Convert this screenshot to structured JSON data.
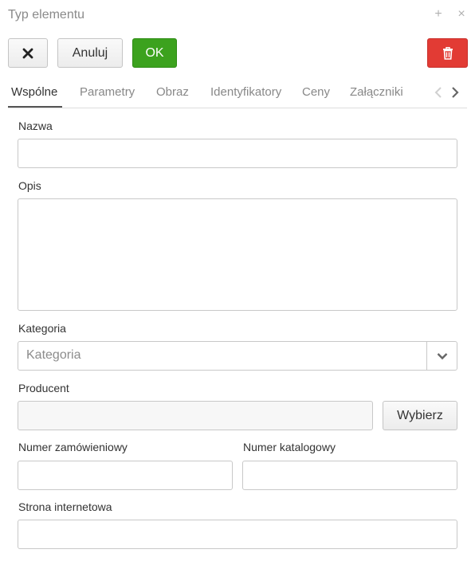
{
  "dialog": {
    "title": "Typ elementu",
    "window_buttons": {
      "maximize_glyph": "+",
      "close_glyph": "×"
    }
  },
  "toolbar": {
    "close_icon": "close-x-icon",
    "cancel_label": "Anuluj",
    "ok_label": "OK",
    "delete_icon": "trash-icon",
    "ok_color": "#3ca21e",
    "delete_color": "#e23b34"
  },
  "tabs": {
    "items": [
      {
        "label": "Wspólne",
        "active": true
      },
      {
        "label": "Parametry",
        "active": false
      },
      {
        "label": "Obraz",
        "active": false
      },
      {
        "label": "Identyfikatory",
        "active": false
      },
      {
        "label": "Ceny",
        "active": false
      },
      {
        "label": "Załączniki",
        "active": false
      }
    ],
    "prev_icon": "chevron-left-icon",
    "next_icon": "chevron-right-icon"
  },
  "form": {
    "name": {
      "label": "Nazwa",
      "value": ""
    },
    "description": {
      "label": "Opis",
      "value": ""
    },
    "category": {
      "label": "Kategoria",
      "placeholder": "Kategoria"
    },
    "producer": {
      "label": "Producent",
      "value": "",
      "choose_label": "Wybierz"
    },
    "order_number": {
      "label": "Numer zamówieniowy",
      "value": ""
    },
    "catalog_number": {
      "label": "Numer katalogowy",
      "value": ""
    },
    "website": {
      "label": "Strona internetowa",
      "value": ""
    }
  }
}
